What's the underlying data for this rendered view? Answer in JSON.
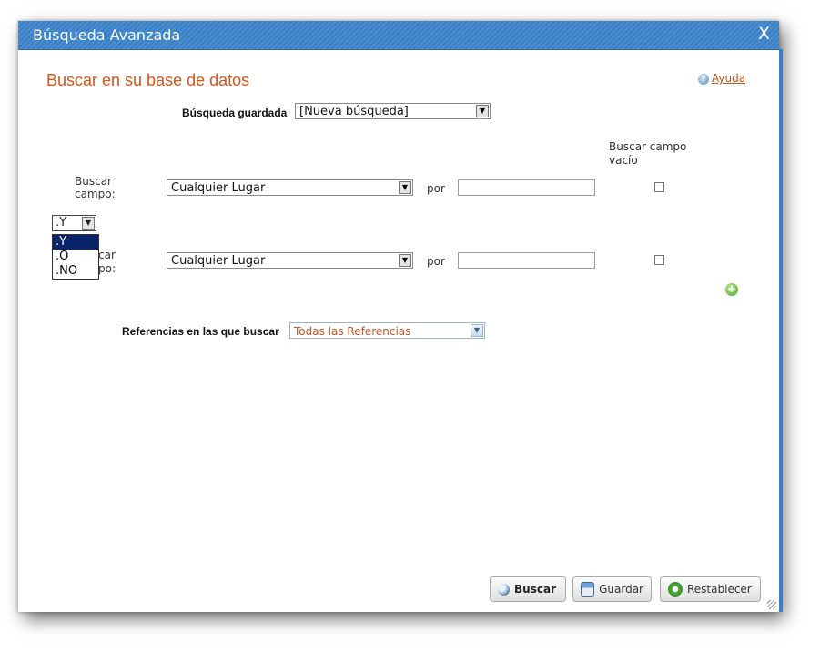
{
  "window": {
    "title": "Búsqueda Avanzada",
    "close_label": "X"
  },
  "heading": "Buscar en su base de datos",
  "help": {
    "label": "Ayuda",
    "icon": "help-icon"
  },
  "saved_search": {
    "label": "Búsqueda guardada",
    "value": "[Nueva búsqueda]"
  },
  "empty_field_header": {
    "line1": "Buscar campo",
    "line2": "vacío"
  },
  "rows": [
    {
      "label_line1": "Buscar",
      "label_line2": "campo:",
      "field": "Cualquier Lugar",
      "por": "por",
      "value": "",
      "empty_checked": false
    },
    {
      "label_line1": "car",
      "label_line2": "po:",
      "field": "Cualquier Lugar",
      "por": "por",
      "value": "",
      "empty_checked": false
    }
  ],
  "operator_dropdown": {
    "selected": ".Y",
    "options": [
      ".Y",
      ".O",
      ".NO"
    ]
  },
  "references": {
    "label": "Referencias en las que buscar",
    "value": "Todas las Referencias"
  },
  "buttons": {
    "search": "Buscar",
    "save": "Guardar",
    "reset": "Restablecer"
  },
  "colors": {
    "title_bar": "#3b7fc4",
    "heading": "#d5541a",
    "selected_option": "#0a246a"
  }
}
